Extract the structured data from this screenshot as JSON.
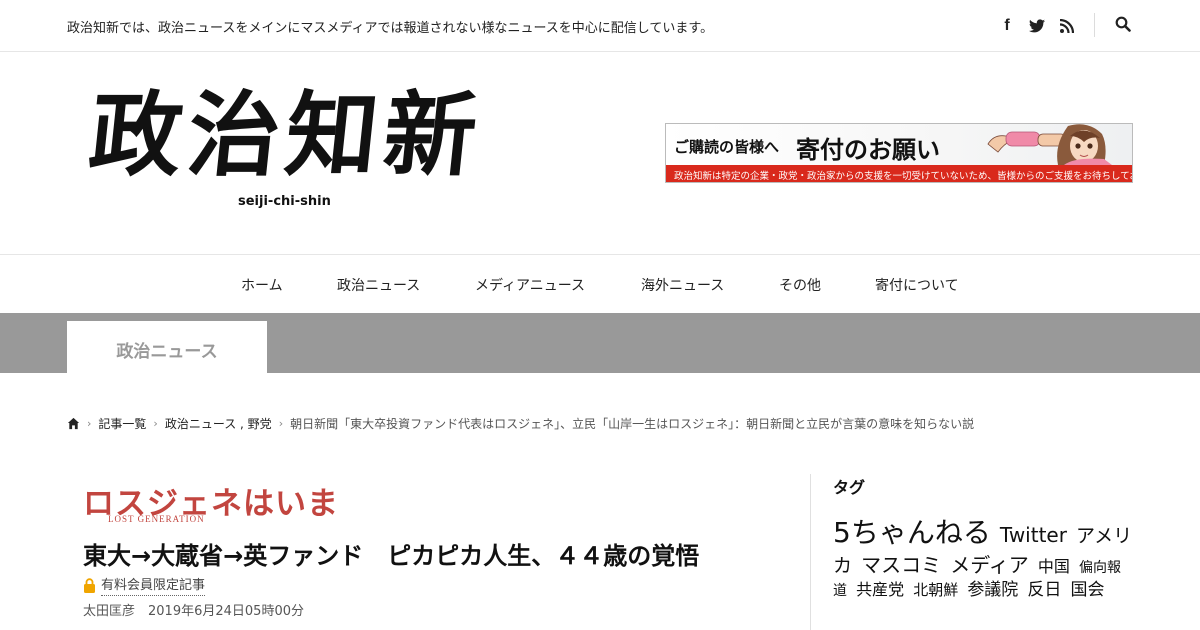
{
  "header": {
    "tagline": "政治知新では、政治ニュースをメインにマスメディアでは報道されない様なニュースを中心に配信しています。",
    "social_icons": [
      "facebook-icon",
      "twitter-icon",
      "rss-icon"
    ],
    "search_icon": "search-icon",
    "logo": {
      "main": "政治知新",
      "sub": "seiji-chi-shin"
    },
    "banner": {
      "lead": "ご購読の皆様へ",
      "title": "寄付のお願い",
      "note": "政治知新は特定の企業・政党・政治家からの支援を一切受けていないため、皆様からのご支援をお待ちしております。",
      "note_color": "#d9291c"
    }
  },
  "nav": {
    "items": [
      {
        "label": "ホーム"
      },
      {
        "label": "政治ニュース"
      },
      {
        "label": "メディアニュース"
      },
      {
        "label": "海外ニュース"
      },
      {
        "label": "その他"
      },
      {
        "label": "寄付について"
      }
    ]
  },
  "category": {
    "title": "政治ニュース",
    "band_color": "#999999"
  },
  "breadcrumb": {
    "home_icon": "home-icon",
    "items": [
      {
        "label": "記事一覧"
      },
      {
        "label": "政治ニュース , 野党"
      },
      {
        "label": "朝日新聞「東大卒投資ファンド代表はロスジェネ」、立民「山岸一生はロスジェネ」：朝日新聞と立民が言葉の意味を知らない説"
      }
    ]
  },
  "article_image": {
    "series": "ロスジェネはいま",
    "series_sub": "LOST GENERATION",
    "headline": "東大→大蔵省→英ファンド　ピカピカ人生、４４歳の覚悟",
    "paid_label": "有料会員限定記事",
    "byline": "太田匡彦　2019年6月24日05時00分",
    "accent": "#c2453f"
  },
  "sidebar": {
    "title": "タグ",
    "tags": [
      {
        "label": "5ちゃんねる"
      },
      {
        "label": "Twitter"
      },
      {
        "label": "アメリカ"
      },
      {
        "label": "マスコミ"
      },
      {
        "label": "メディア"
      },
      {
        "label": "中国"
      },
      {
        "label": "偏向報道"
      },
      {
        "label": "共産党"
      },
      {
        "label": "北朝鮮"
      },
      {
        "label": "参議院"
      },
      {
        "label": "反日"
      },
      {
        "label": "国会"
      }
    ]
  }
}
